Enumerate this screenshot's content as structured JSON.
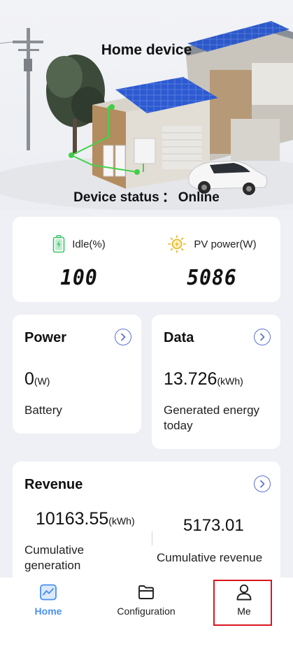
{
  "hero": {
    "title": "Home device",
    "status_label": "Device status",
    "status_separator": "：",
    "status_value": "Online"
  },
  "stats": {
    "idle": {
      "label": "Idle(%)",
      "value": "100",
      "icon": "battery-icon"
    },
    "pv": {
      "label": "PV power(W)",
      "value": "5086",
      "icon": "sun-icon"
    }
  },
  "power": {
    "title": "Power",
    "value": "0",
    "unit": "(W)",
    "label": "Battery"
  },
  "data_card": {
    "title": "Data",
    "value": "13.726",
    "unit": "(kWh)",
    "label": "Generated energy today"
  },
  "revenue": {
    "title": "Revenue",
    "generation_value": "10163.55",
    "generation_unit": "(kWh)",
    "generation_label": "Cumulative generation",
    "revenue_value": "5173.01",
    "revenue_label": "Cumulative revenue"
  },
  "nav": {
    "home": "Home",
    "config": "Configuration",
    "me": "Me"
  },
  "colors": {
    "accent": "#4a90f0",
    "chevron": "#5b6fd6",
    "highlight": "#d9161f",
    "battery": "#3cc26a",
    "sun": "#e8b21a"
  }
}
